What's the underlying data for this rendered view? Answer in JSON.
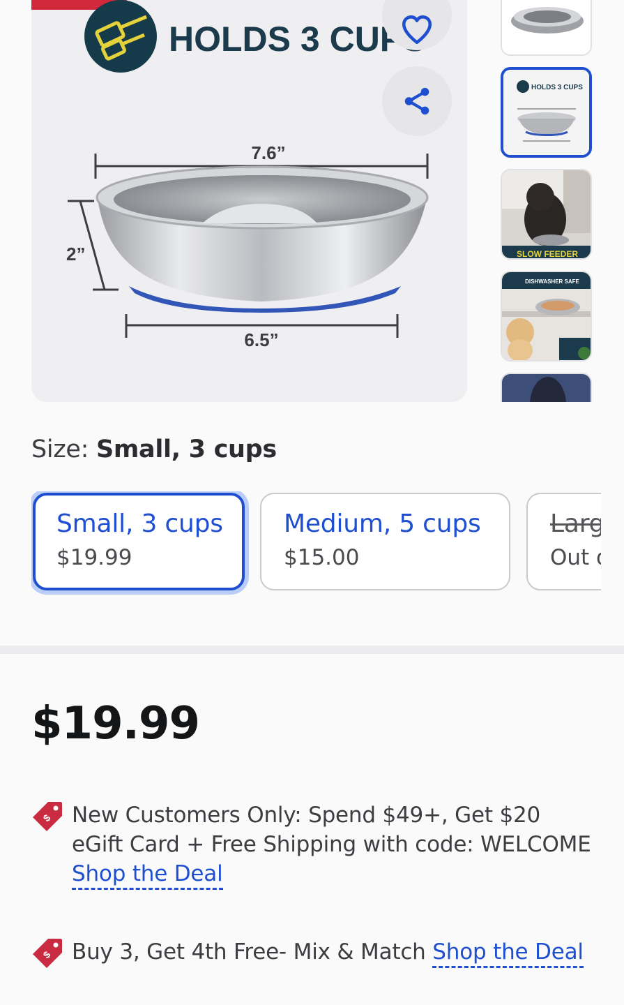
{
  "gallery": {
    "main_image": {
      "headline": "HOLDS 3 CUPS",
      "dimensions": {
        "width_top": "7.6”",
        "width_bottom": "6.5”",
        "height": "2”"
      }
    },
    "thumbnails": [
      {
        "label": ""
      },
      {
        "label": "HOLDS 3 CUPS"
      },
      {
        "label": "SLOW FEEDER"
      },
      {
        "label": "DISHWASHER SAFE"
      },
      {
        "label": ""
      }
    ],
    "active_thumbnail": 1,
    "colors": {
      "accent": "#1f4fd1",
      "sale": "#d2283c",
      "bowl_base": "#3255b8"
    }
  },
  "size": {
    "label": "Size:",
    "selected": "Small, 3 cups",
    "options": [
      {
        "name": "Small, 3 cups",
        "price": "$19.99",
        "selected": true,
        "available": true
      },
      {
        "name": "Medium, 5 cups",
        "price": "$15.00",
        "selected": false,
        "available": true
      },
      {
        "name": "Large",
        "price": "Out of stock",
        "selected": false,
        "available": false
      }
    ]
  },
  "price": "$19.99",
  "promos": [
    {
      "icon": "price-tag-icon",
      "text": "New Customers Only: Spend $49+, Get $20 eGift Card + Free Shipping with code: WELCOME",
      "link": "Shop the Deal"
    },
    {
      "icon": "price-tag-icon",
      "text": "Buy 3, Get 4th Free- Mix & Match",
      "link": "Shop the Deal"
    }
  ]
}
